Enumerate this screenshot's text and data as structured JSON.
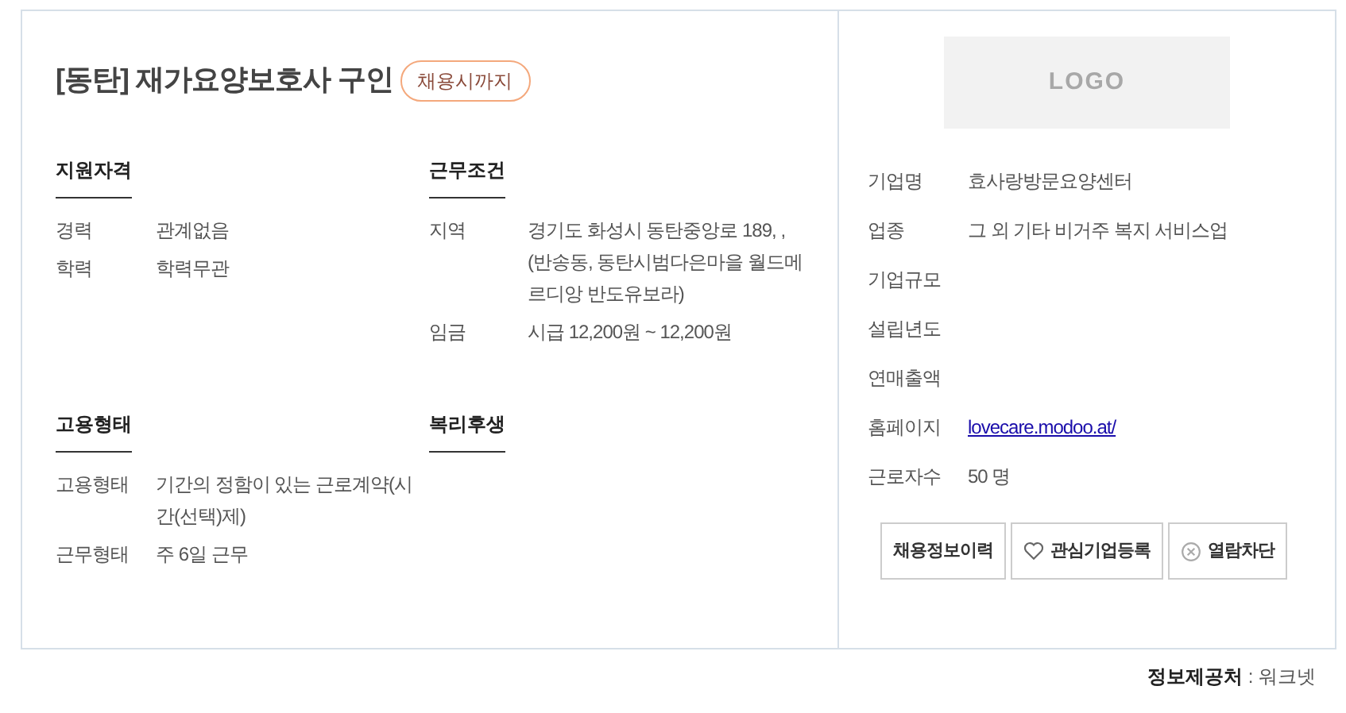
{
  "job": {
    "title": "[동탄] 재가요양보호사 구인",
    "deadline_badge": "채용시까지"
  },
  "sections": [
    {
      "heading": "지원자격",
      "rows": [
        {
          "label": "경력",
          "value": "관계없음"
        },
        {
          "label": "학력",
          "value": "학력무관"
        }
      ]
    },
    {
      "heading": "근무조건",
      "rows": [
        {
          "label": "지역",
          "value": "경기도 화성시 동탄중앙로 189, , (반송동, 동탄시범다은마을 월드메르디앙 반도유보라)"
        },
        {
          "label": "임금",
          "value": "시급 12,200원 ~ 12,200원"
        }
      ]
    },
    {
      "heading": "고용형태",
      "rows": [
        {
          "label": "고용형태",
          "value": "기간의 정함이 있는 근로계약(시간(선택)제)"
        },
        {
          "label": "근무형태",
          "value": "주 6일 근무"
        }
      ]
    },
    {
      "heading": "복리후생"
    }
  ],
  "company": {
    "logo": "LOGO",
    "rows": [
      {
        "label": "기업명",
        "value": "효사랑방문요양센터",
        "kind": "text"
      },
      {
        "label": "업종",
        "value": "그 외 기타 비거주 복지 서비스업",
        "kind": "text"
      },
      {
        "label": "기업규모"
      },
      {
        "label": "설립년도"
      },
      {
        "label": "연매출액"
      },
      {
        "label": "홈페이지",
        "value": "lovecare.modoo.at/",
        "kind": "link"
      },
      {
        "label": "근로자수",
        "value": "50 명",
        "kind": "text"
      }
    ],
    "buttons": [
      {
        "label": "채용정보이력",
        "kind": "plain"
      },
      {
        "label": "관심기업등록",
        "kind": "favorite"
      },
      {
        "label": "열람차단",
        "kind": "block"
      }
    ]
  },
  "source": {
    "label": "정보제공처",
    "separator": " : ",
    "value": "워크넷"
  }
}
